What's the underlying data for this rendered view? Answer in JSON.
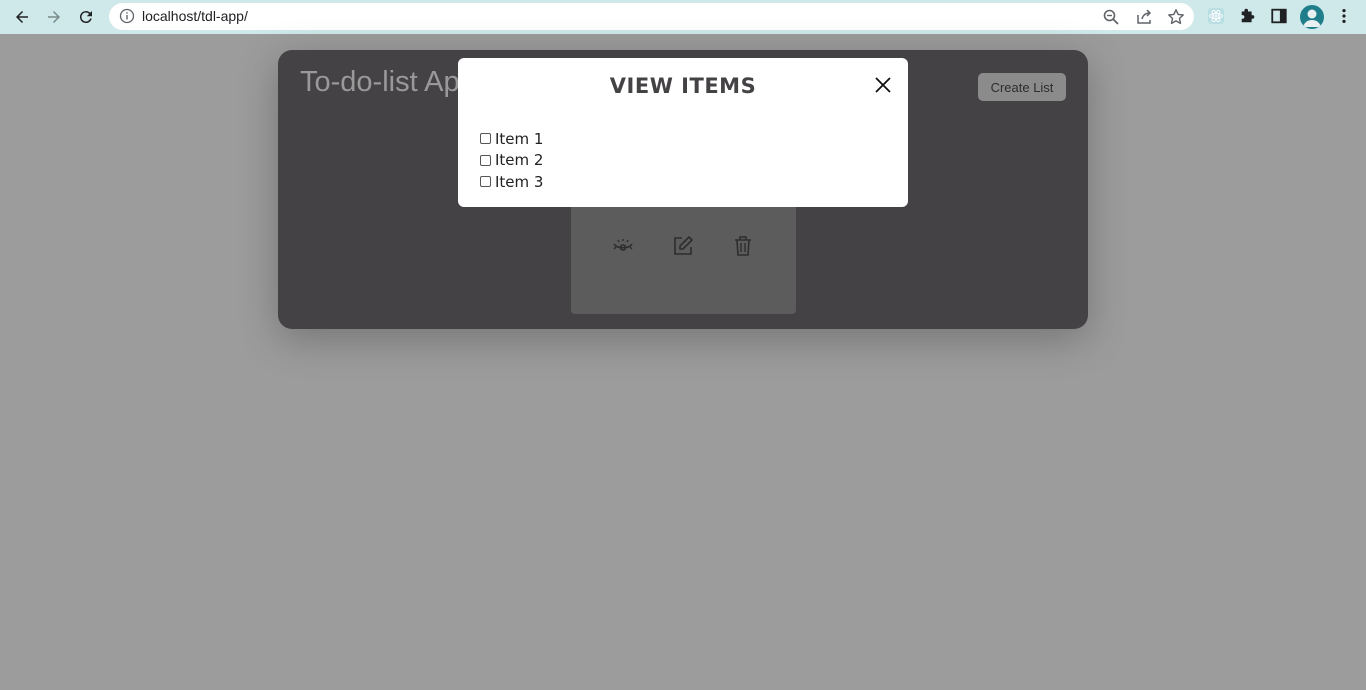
{
  "browser": {
    "url": "localhost/tdl-app/",
    "accent": "#cfe8e9"
  },
  "app": {
    "title": "To-do-list App",
    "create_label": "Create List",
    "card_colors": {
      "panel": "#444244",
      "card": "#5d5c5d"
    }
  },
  "modal": {
    "title": "VIEW ITEMS",
    "items": [
      {
        "label": "Item 1",
        "checked": false
      },
      {
        "label": "Item 2",
        "checked": false
      },
      {
        "label": "Item 3",
        "checked": false
      }
    ]
  }
}
